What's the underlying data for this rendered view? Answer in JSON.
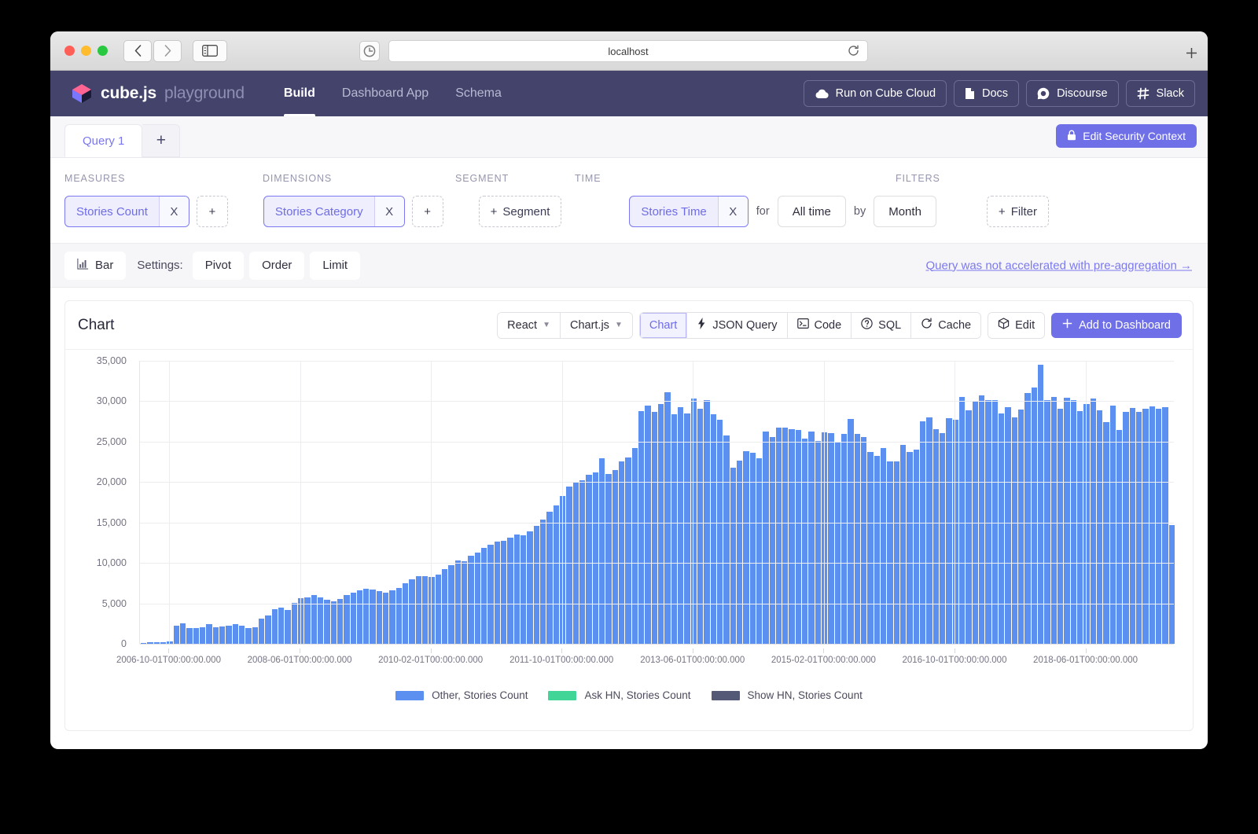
{
  "browser": {
    "url": "localhost",
    "back_icon": "chevron-left-icon",
    "forward_icon": "chevron-right-icon",
    "sidebar_icon": "sidebar-toggle-icon",
    "reload_icon": "reload-icon",
    "new_tab_icon": "plus-icon"
  },
  "header": {
    "brand_name": "cube.js",
    "brand_sub": "playground",
    "nav": [
      {
        "label": "Build",
        "active": true
      },
      {
        "label": "Dashboard App",
        "active": false
      },
      {
        "label": "Schema",
        "active": false
      }
    ],
    "buttons": [
      {
        "label": "Run on Cube Cloud",
        "icon": "cloud-icon"
      },
      {
        "label": "Docs",
        "icon": "document-icon"
      },
      {
        "label": "Discourse",
        "icon": "discourse-icon"
      },
      {
        "label": "Slack",
        "icon": "slack-icon"
      }
    ]
  },
  "tabs": {
    "query_tab": "Query 1",
    "add_tab": "+",
    "security_button": "Edit Security Context",
    "security_icon": "lock-icon"
  },
  "builder": {
    "labels": {
      "measures": "MEASURES",
      "dimensions": "DIMENSIONS",
      "segment": "SEGMENT",
      "time": "TIME",
      "filters": "FILTERS"
    },
    "measure_pill": "Stories Count",
    "measure_remove": "X",
    "dimension_pill": "Stories Category",
    "dimension_remove": "X",
    "add_symbol": "+",
    "segment_button": "Segment",
    "time_pill": "Stories Time",
    "time_remove": "X",
    "for_label": "for",
    "date_range": "All time",
    "by_label": "by",
    "granularity": "Month",
    "filter_button": "Filter"
  },
  "settings": {
    "chart_type": "Bar",
    "chart_type_icon": "bar-chart-icon",
    "settings_label": "Settings:",
    "pivot": "Pivot",
    "order": "Order",
    "limit": "Limit",
    "accel_notice": "Query was not accelerated with pre-aggregation →"
  },
  "chart_card": {
    "title": "Chart",
    "framework": "React",
    "library": "Chart.js",
    "tabs": [
      {
        "label": "Chart",
        "icon": null,
        "selected": true
      },
      {
        "label": "JSON Query",
        "icon": "lightning-icon",
        "selected": false
      },
      {
        "label": "Code",
        "icon": "terminal-icon",
        "selected": false
      },
      {
        "label": "SQL",
        "icon": "question-circle-icon",
        "selected": false
      },
      {
        "label": "Cache",
        "icon": "refresh-icon",
        "selected": false
      }
    ],
    "edit_label": "Edit",
    "edit_icon": "cube-icon",
    "add_to_dashboard": "Add to Dashboard",
    "add_icon": "plus-icon",
    "chevron_icon": "chevron-down-icon"
  },
  "chart_data": {
    "type": "bar",
    "title": "Chart",
    "xlabel": "",
    "ylabel": "",
    "ylim": [
      0,
      35000
    ],
    "grid": true,
    "legend_position": "bottom",
    "ytick_labels": [
      "35,000",
      "30,000",
      "25,000",
      "20,000",
      "15,000",
      "10,000",
      "5,000",
      "0"
    ],
    "ytick_values": [
      35000,
      30000,
      25000,
      20000,
      15000,
      10000,
      5000,
      0
    ],
    "xtick_labels": [
      "2006-10-01T00:00:00.000",
      "2008-06-01T00:00:00.000",
      "2010-02-01T00:00:00.000",
      "2011-10-01T00:00:00.000",
      "2013-06-01T00:00:00.000",
      "2015-02-01T00:00:00.000",
      "2016-10-01T00:00:00.000",
      "2018-06-01T00:00:00.000"
    ],
    "xtick_indices": [
      4,
      24,
      44,
      64,
      84,
      104,
      124,
      144
    ],
    "legend": [
      {
        "name": "Other, Stories Count",
        "color": "#5b8ff0"
      },
      {
        "name": "Ask HN, Stories Count",
        "color": "#41d597"
      },
      {
        "name": "Show HN, Stories Count",
        "color": "#545a75"
      }
    ],
    "series": [
      {
        "name": "Other, Stories Count",
        "color": "#5b8ff0",
        "values": [
          120,
          150,
          180,
          210,
          330,
          2250,
          2500,
          1950,
          1900,
          2050,
          2400,
          2050,
          2150,
          2250,
          2450,
          2250,
          1950,
          2000,
          3100,
          3550,
          4250,
          4500,
          4200,
          5100,
          5650,
          5750,
          6000,
          5750,
          5400,
          5300,
          5500,
          6050,
          6350,
          6650,
          6800,
          6750,
          6500,
          6350,
          6600,
          6900,
          7450,
          8000,
          8350,
          8400,
          8300,
          8600,
          9200,
          9750,
          10350,
          10250,
          10850,
          11300,
          11850,
          12250,
          12600,
          12700,
          13150,
          13500,
          13400,
          13900,
          14600,
          15400,
          16300,
          17100,
          18250,
          19450,
          19900,
          20250,
          20950,
          21150,
          22950,
          21050,
          21500,
          22600,
          23050,
          24200,
          28800,
          29450,
          28700,
          29700,
          31150,
          28350,
          29300,
          28450,
          30300,
          29100,
          30100,
          28400,
          27700,
          25800,
          21800,
          22700,
          23800,
          23600,
          22900,
          26300,
          25600,
          26750,
          26700,
          26550,
          26400,
          25400,
          26300,
          25100,
          26200,
          26050,
          25000,
          26000,
          27800,
          26000,
          25600,
          23700,
          23250,
          24200,
          22600,
          22550,
          24600,
          23700,
          24000,
          27500,
          28000,
          26500,
          26100,
          27900,
          27700,
          30500,
          28900,
          29900,
          30700,
          30100,
          30150,
          28500,
          29300,
          28000,
          29000,
          31000,
          31700,
          34500,
          30100,
          30500,
          29100,
          30400,
          30100,
          28800,
          29700,
          30300,
          28900,
          27400,
          29500,
          26400,
          28700,
          29200,
          28700,
          29100,
          29400,
          29100,
          29300,
          14700
        ]
      },
      {
        "name": "Ask HN, Stories Count",
        "color": "#41d597",
        "values": []
      },
      {
        "name": "Show HN, Stories Count",
        "color": "#545a75",
        "values": []
      }
    ]
  }
}
